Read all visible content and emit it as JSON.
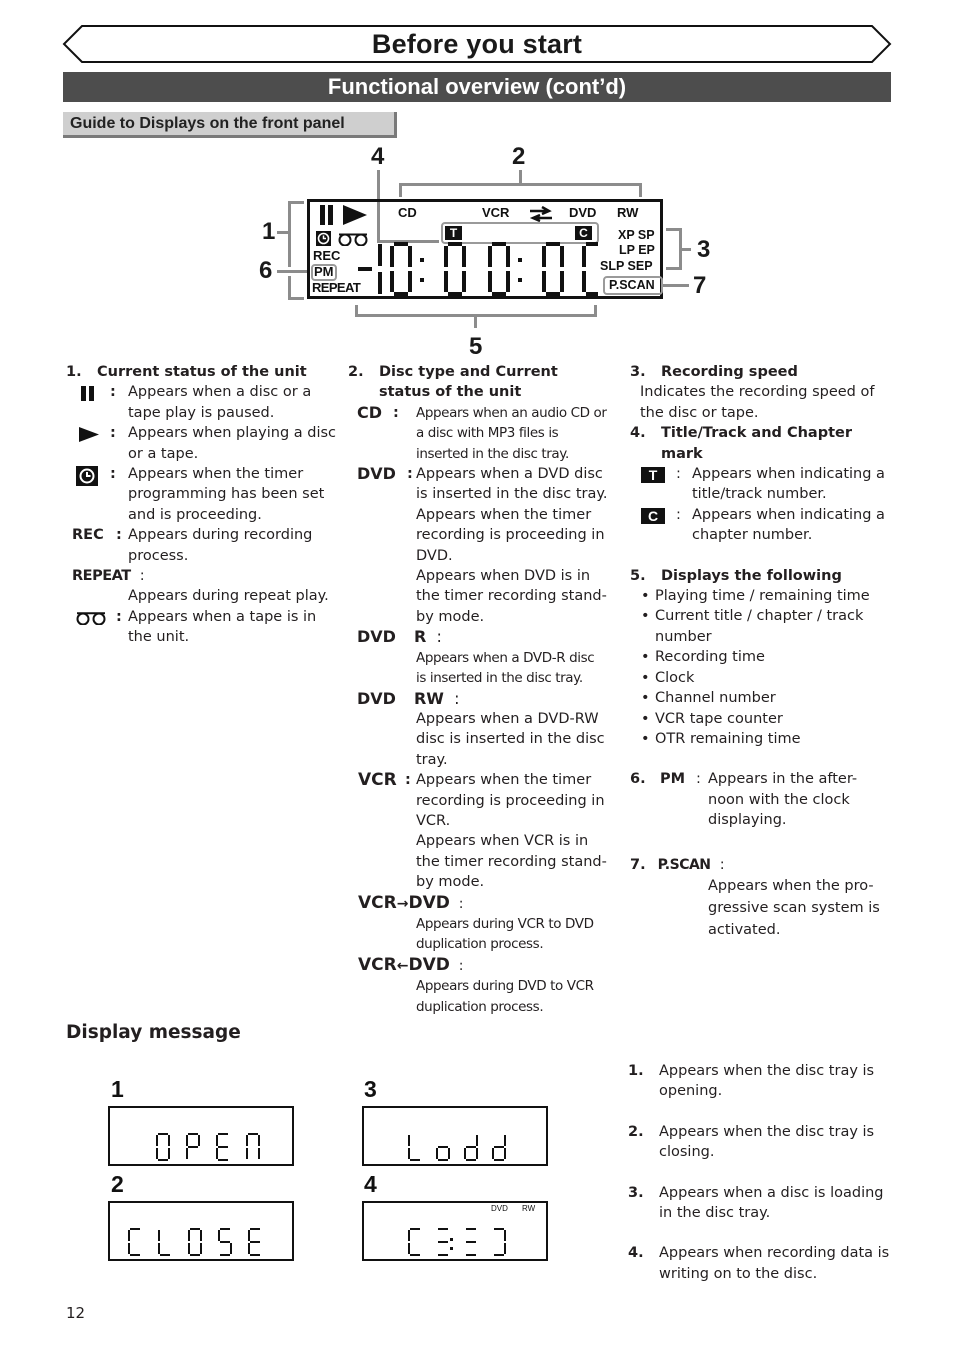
{
  "header": {
    "title": "Before you start",
    "section": "Functional overview (cont’d)",
    "subsection": "Guide to Displays on the front panel"
  },
  "diagram": {
    "callouts": [
      "1",
      "2",
      "3",
      "4",
      "5",
      "6",
      "7"
    ],
    "lcd": {
      "top_labels": [
        "CD",
        "VCR",
        "DVD",
        "RW"
      ],
      "left_labels": {
        "rec": "REC",
        "pm": "PM",
        "repeat": "REPEAT"
      },
      "speed_labels": [
        "XP SP",
        "LP EP",
        "SLP SEP"
      ],
      "pscan": "P.SCAN",
      "title_mark": "T",
      "chapter_mark": "C"
    }
  },
  "col1": {
    "heading_num": "1.",
    "heading": "Current status of the unit",
    "items": [
      {
        "symbol": "pause-icon",
        "text": "Appears when a disc or a tape play is paused."
      },
      {
        "symbol": "play-icon",
        "text": "Appears when playing a disc or a tape."
      },
      {
        "symbol": "timer-icon",
        "text": "Appears when the timer programming has been set and is proceeding."
      },
      {
        "label": "REC",
        "text": "Appears during recording process."
      },
      {
        "label": "REPEAT",
        "text": "Appears during repeat play."
      },
      {
        "symbol": "tape-icon",
        "text": "Appears when a tape is in the unit."
      }
    ]
  },
  "col2": {
    "heading_num": "2.",
    "heading_line1": "Disc type and Current",
    "heading_line2": "status of the unit",
    "items": [
      {
        "label": "CD",
        "text": "Appears when an audio CD or a disc with MP3 files is inserted in the disc tray."
      },
      {
        "label": "DVD",
        "text": "Appears when a DVD disc is inserted in the disc tray.",
        "text2": "Appears when the timer recording is proceeding in DVD.",
        "text3": "Appears when DVD is in the timer recording stand-by mode."
      },
      {
        "label": "DVD",
        "label2": "R",
        "text": "Appears when a DVD-R disc is inserted in the disc tray."
      },
      {
        "label": "DVD",
        "label2": "RW",
        "text": "Appears when a DVD-RW disc is inserted in the disc tray."
      },
      {
        "label": "VCR",
        "text": "Appears when the timer recording is proceeding in VCR.",
        "text2": "Appears when VCR is in the timer recording stand-by mode."
      },
      {
        "label": "VCR",
        "arrow": "→",
        "label2": "DVD",
        "text": "Appears during VCR to DVD duplication process."
      },
      {
        "label": "VCR",
        "arrow": "←",
        "label2": "DVD",
        "text": "Appears during DVD to VCR duplication process."
      }
    ]
  },
  "col3": {
    "s3": {
      "num": "3.",
      "heading": "Recording speed",
      "text": "Indicates the recording speed of the disc or tape."
    },
    "s4": {
      "num": "4.",
      "heading_line1": "Title/Track and Chapter",
      "heading_line2": "mark",
      "items": [
        {
          "symbol": "T",
          "text": "Appears when indicating a title/track number."
        },
        {
          "symbol": "C",
          "text": "Appears when indicating a chapter number."
        }
      ]
    },
    "s5": {
      "num": "5.",
      "heading": "Displays the following",
      "bullets": [
        "Playing time / remaining time",
        "Current title / chapter / track number",
        "Recording time",
        "Clock",
        "Channel number",
        "VCR tape counter",
        "OTR remaining time"
      ]
    },
    "s6": {
      "num": "6.",
      "label": "PM",
      "text": "Appears in the after-noon with the clock displaying."
    },
    "s7": {
      "num": "7.",
      "label": "P.SCAN",
      "text": "Appears when the pro-gressive scan system is activated."
    }
  },
  "display_message": {
    "title": "Display message",
    "panels": [
      {
        "num": "1",
        "display": "OPEN"
      },
      {
        "num": "2",
        "display": "CLOSE"
      },
      {
        "num": "3",
        "display": "LOAD"
      },
      {
        "num": "4",
        "display": "C:::]",
        "indicators": [
          "DVD",
          "RW"
        ]
      }
    ],
    "descriptions": [
      {
        "num": "1.",
        "text": "Appears when the disc tray is opening."
      },
      {
        "num": "2.",
        "text": "Appears when the disc tray is closing."
      },
      {
        "num": "3.",
        "text": "Appears when a disc is loading in the disc tray."
      },
      {
        "num": "4.",
        "text": "Appears when recording data is writing on to the disc."
      }
    ]
  },
  "page_number": "12"
}
